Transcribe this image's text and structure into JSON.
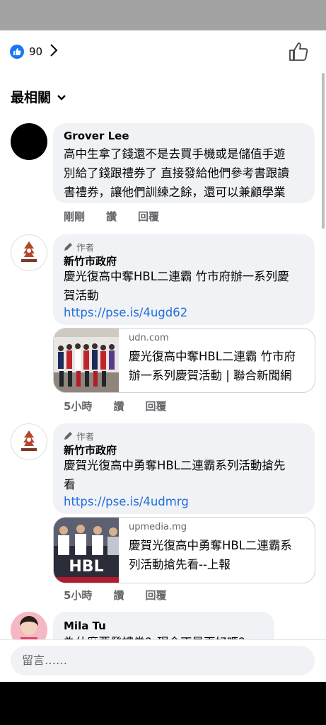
{
  "reactions": {
    "count": "90",
    "icon": "like-icon",
    "color": "#1877f2"
  },
  "sort": {
    "label": "最相關"
  },
  "comments": [
    {
      "name": "Grover Lee",
      "lines": [
        "高中生拿了錢還不是去買手機或是儲值手遊",
        "別給了錢跟禮券了 直接發給他們參考書跟讀",
        "書禮券，讓他們訓練之餘，還可以兼顧學業"
      ],
      "time": "剛剛",
      "like": "讚",
      "reply": "回覆"
    },
    {
      "author_tag": "作者",
      "name": "新竹市政府",
      "lines": [
        "慶光復高中奪HBL二連霸 竹市府辦一系列慶",
        "賀活動"
      ],
      "link": "https://pse.is/4ugd62",
      "card": {
        "domain": "udn.com",
        "title_lines": [
          "慶光復高中奪HBL二連霸 竹市府",
          "辦一系列慶賀活動 | 聯合新聞網"
        ]
      },
      "time": "5小時",
      "like": "讚",
      "reply": "回覆"
    },
    {
      "author_tag": "作者",
      "name": "新竹市政府",
      "lines": [
        "慶賀光復高中勇奪HBL二連霸系列活動搶先",
        "看"
      ],
      "link": "https://pse.is/4udmrg",
      "card": {
        "domain": "upmedia.mg",
        "title_lines": [
          "慶賀光復高中勇奪HBL二連霸系",
          "列活動搶先看--上報"
        ]
      },
      "time": "5小時",
      "like": "讚",
      "reply": "回覆"
    },
    {
      "name": "Mila Tu",
      "lines": [
        "為什麼要發禮券？現金不是更好嗎？"
      ]
    }
  ],
  "composer": {
    "placeholder": "留言……"
  }
}
